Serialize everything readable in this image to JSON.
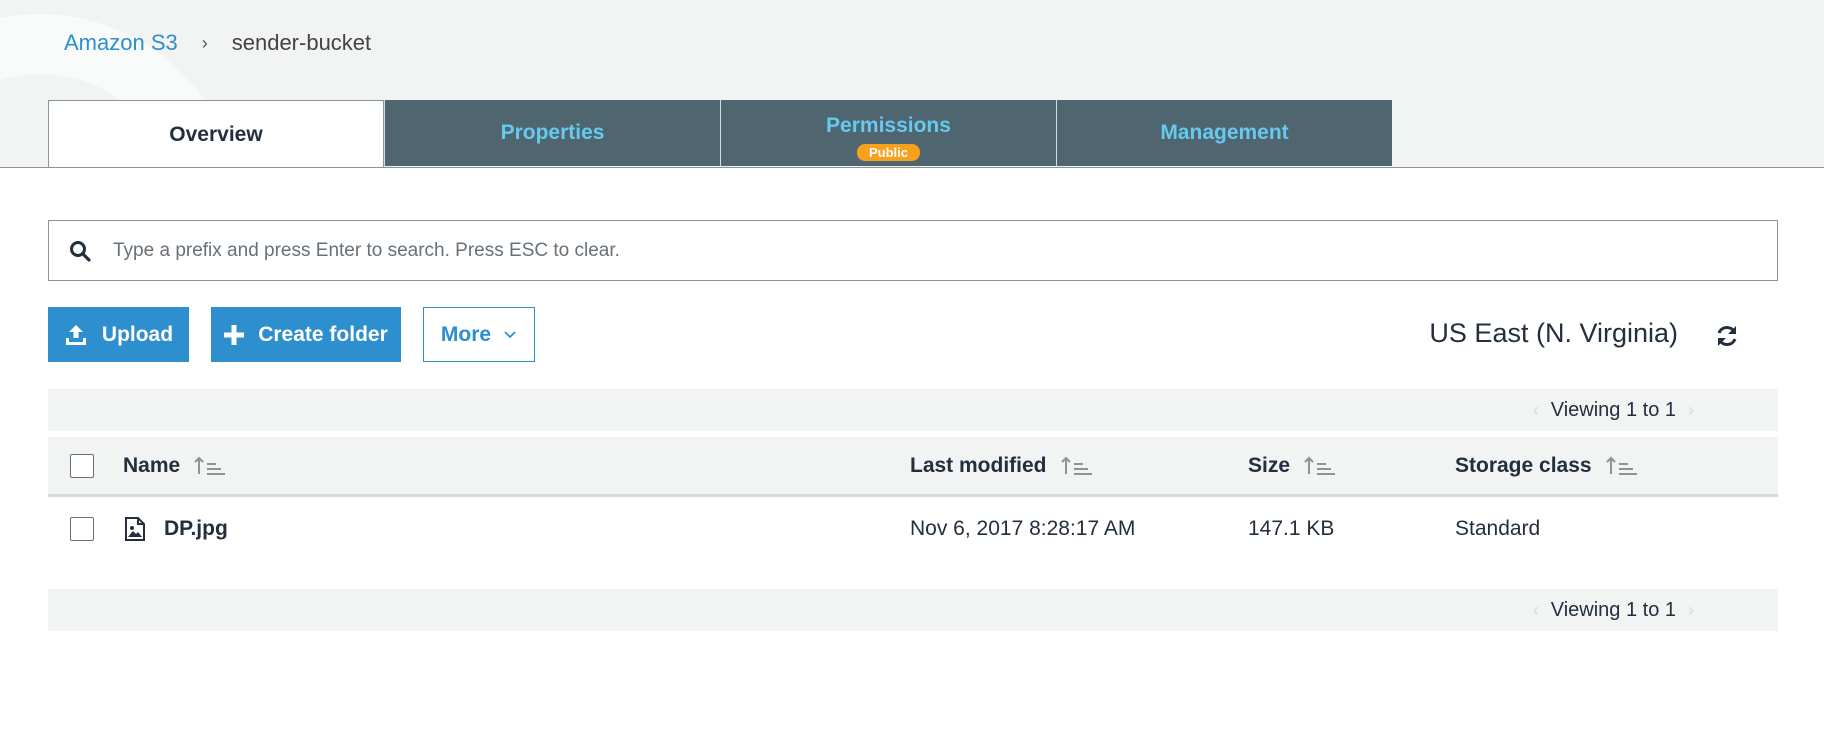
{
  "breadcrumb": {
    "root": "Amazon S3",
    "separator": "›",
    "current": "sender-bucket"
  },
  "tabs": [
    {
      "label": "Overview",
      "active": true
    },
    {
      "label": "Properties"
    },
    {
      "label": "Permissions",
      "badge": "Public"
    },
    {
      "label": "Management"
    }
  ],
  "search": {
    "placeholder": "Type a prefix and press Enter to search. Press ESC to clear."
  },
  "toolbar": {
    "upload_label": "Upload",
    "create_folder_label": "Create folder",
    "more_label": "More"
  },
  "region": "US East (N. Virginia)",
  "pagination": {
    "viewing_text": "Viewing 1 to 1"
  },
  "table": {
    "columns": [
      "Name",
      "Last modified",
      "Size",
      "Storage class"
    ],
    "rows": [
      {
        "name": "DP.jpg",
        "last_modified": "Nov 6, 2017 8:28:17 AM",
        "size": "147.1 KB",
        "storage_class": "Standard"
      }
    ]
  },
  "colors": {
    "accent": "#2e8fcf",
    "tab_inactive_bg": "#4f6570",
    "tab_inactive_text": "#66c9ee",
    "badge": "#f7a01c"
  },
  "icons": [
    "search-icon",
    "upload-icon",
    "plus-icon",
    "chevron-down-icon",
    "refresh-icon",
    "sort-icon",
    "image-file-icon"
  ]
}
